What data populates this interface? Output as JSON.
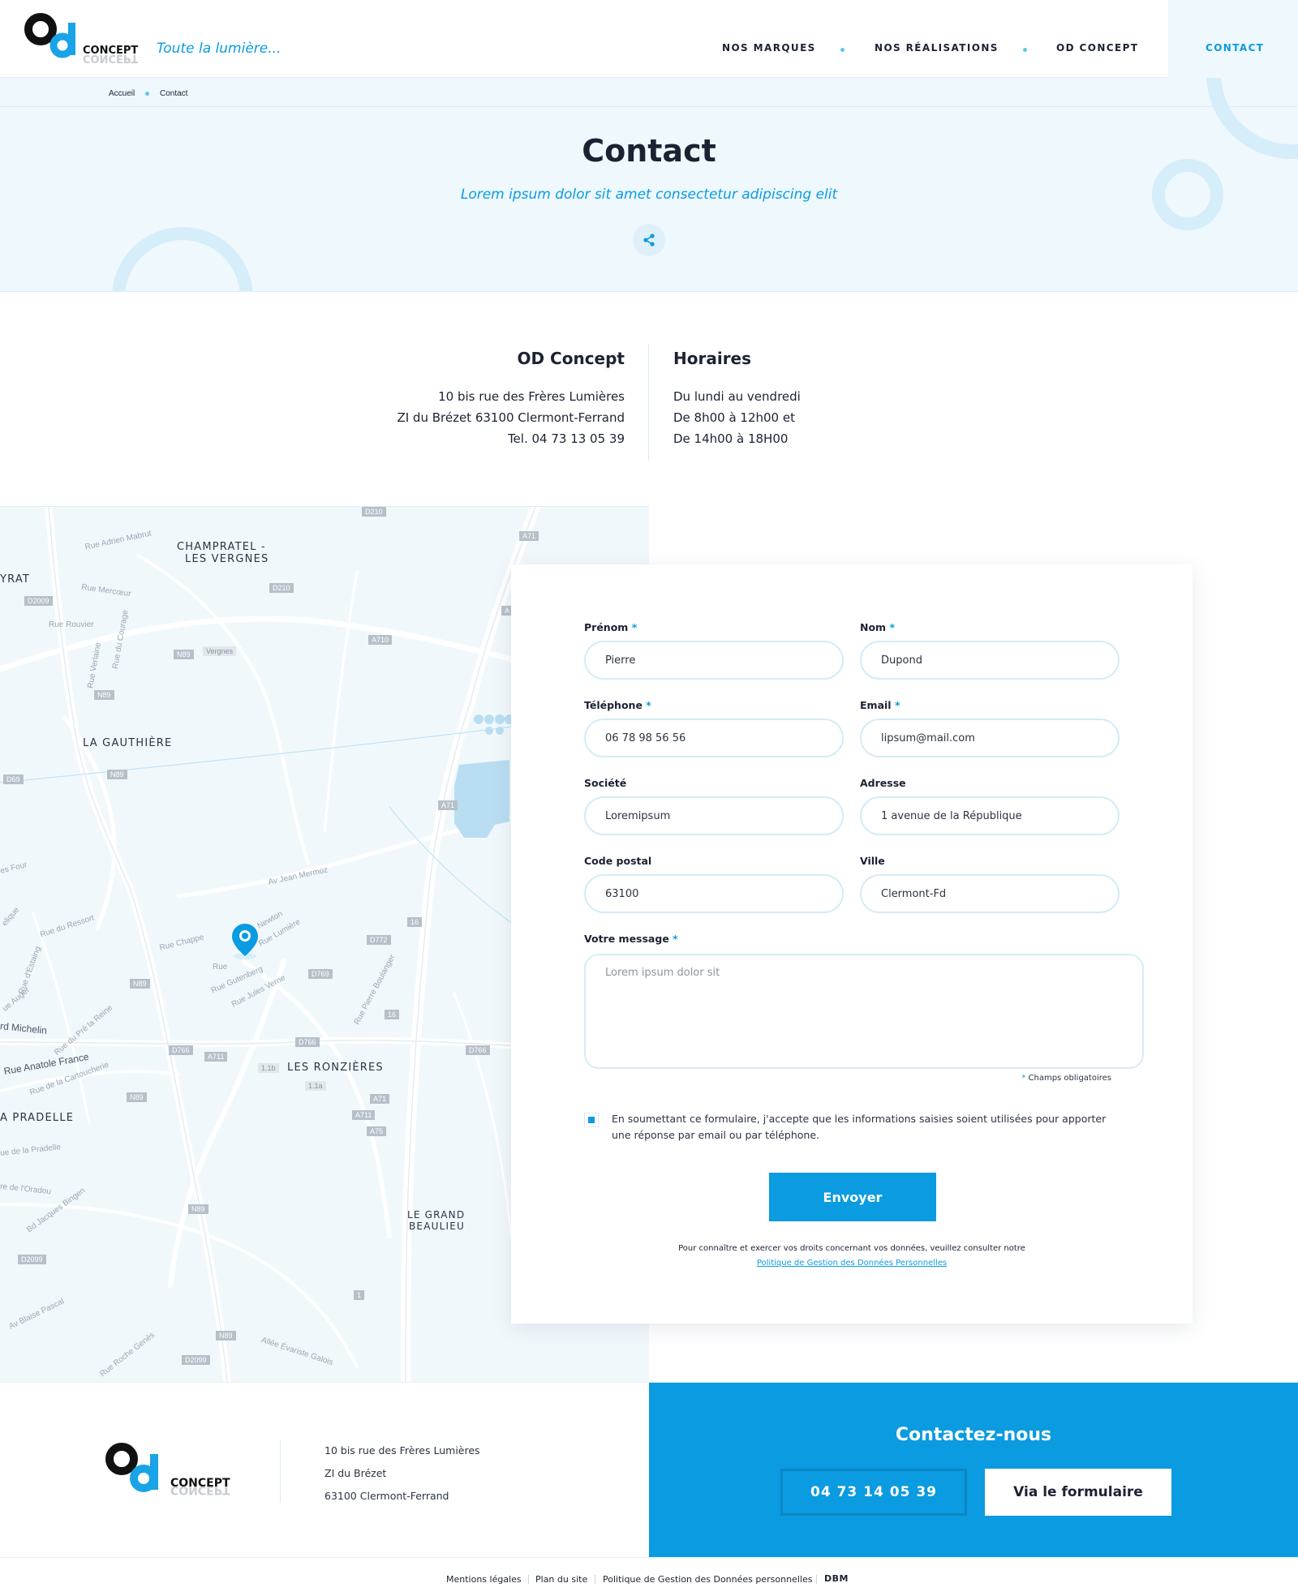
{
  "header": {
    "tagline": "Toute la lumière...",
    "logo_text": "CONCEPT",
    "nav": [
      "NOS MARQUES",
      "NOS RÉALISATIONS",
      "OD CONCEPT"
    ],
    "contact_label": "CONTACT"
  },
  "breadcrumb": [
    "Accueil",
    "Contact"
  ],
  "hero": {
    "title": "Contact",
    "subtitle": "Lorem ipsum dolor sit amet consectetur adipiscing elit"
  },
  "company": {
    "title": "OD Concept",
    "lines": [
      "10 bis rue des Frères Lumières",
      "ZI du Brézet 63100 Clermont-Ferrand",
      "Tel. 04 73 13 05 39"
    ]
  },
  "hours": {
    "title": "Horaires",
    "lines": [
      "Du lundi au vendredi",
      "De 8h00 à 12h00 et",
      "De 14h00 à 18H00"
    ]
  },
  "map": {
    "places": [
      "CHAMPRATEL -",
      "LES VERGNES",
      "YRAT",
      "LA GAUTHIÈRE",
      "LES RONZIÈRES",
      "A PRADELLE",
      "LE GRAND",
      "BEAULIEU"
    ],
    "streets": [
      "Rue Adrien Mabrut",
      "Rue Mercœur",
      "Rue Rouvier",
      "Rue du Courage",
      "Rue Verlaine",
      "Av Jean Mermoz",
      "Rue du Ressort",
      "Rue Chappe",
      "Rue Jules Verne",
      "Rue Gutenberg",
      "Rue Pierre Boulanger",
      "rd Michelin",
      "Rue Anatole France",
      "Rue de la Cartoucherie",
      "ue de la Pradelle",
      "re de l'Oradou",
      "Bd Jacques Bingen",
      "Av Blaise Pascal",
      "Rue Roche Genès",
      "Allée Évariste Galois",
      "Rue du Pré la Reine",
      "Rue d'Estaing",
      "ue Auger",
      "es Four",
      "elique",
      "Rue Lumière",
      "Newton",
      "Rue"
    ],
    "roads": [
      "D210",
      "A71",
      "D2009",
      "N89",
      "Vergnes",
      "A710",
      "D69",
      "D772",
      "16",
      "D769",
      "D766",
      "A711",
      "1.1b",
      "1.1a",
      "A75",
      "D2099",
      "1",
      "A"
    ]
  },
  "form": {
    "fields": [
      {
        "label": "Prénom",
        "required": true,
        "value": "Pierre"
      },
      {
        "label": "Nom",
        "required": true,
        "value": "Dupond"
      },
      {
        "label": "Téléphone",
        "required": true,
        "value": "06 78 98 56 56"
      },
      {
        "label": "Email",
        "required": true,
        "value": "lipsum@mail.com"
      },
      {
        "label": "Société",
        "required": false,
        "value": "Loremipsum"
      },
      {
        "label": "Adresse",
        "required": false,
        "value": "1 avenue de la République"
      },
      {
        "label": "Code postal",
        "required": false,
        "value": "63100"
      },
      {
        "label": "Ville",
        "required": false,
        "value": "Clermont-Fd"
      }
    ],
    "message_label": "Votre message",
    "message_placeholder": "Lorem ipsum dolor sit",
    "required_note": "Champs obligatoires",
    "consent": "En soumettant ce formulaire, j'accepte que les informations saisies soient utilisées pour apporter une réponse par email ou par téléphone.",
    "consent_checked": true,
    "submit": "Envoyer",
    "rights_text": "Pour connaître et exercer vos droits concernant vos données, veuillez consulter notre",
    "rights_link": "Politique de Gestion des Données Personnelles"
  },
  "footer": {
    "address": [
      "10 bis rue des Frères Lumières",
      "ZI du Brézet",
      "63100 Clermont-Ferrand"
    ],
    "cta_title": "Contactez-nous",
    "cta_phone": "04 73 14 05 39",
    "cta_form": "Via le formulaire",
    "legal": [
      "Mentions légales",
      "Plan du site",
      "Politique de Gestion des Données personnelles"
    ],
    "credit": "DBM"
  },
  "colors": {
    "accent": "#0a9be0",
    "dark": "#1c2233",
    "light_bg": "#eef8fd"
  }
}
